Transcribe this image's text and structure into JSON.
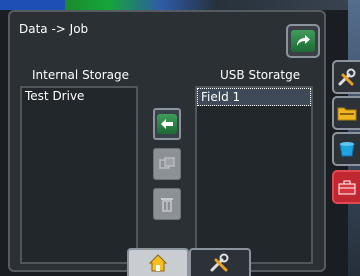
{
  "dialog": {
    "title": "Data -> Job"
  },
  "internal": {
    "label": "Internal Storage",
    "items": [
      "Test Drive"
    ]
  },
  "usb": {
    "label": "USB Storatge",
    "items": [
      "Field 1"
    ]
  },
  "icons": {
    "return": "return-arrow-icon",
    "transfer_left": "arrow-left-icon",
    "copy": "copy-icon",
    "delete": "trash-icon",
    "side_tools": "wrench-screwdriver-icon",
    "side_folder": "folder-icon",
    "side_bucket": "bucket-icon",
    "side_toolbox": "toolbox-icon",
    "bottom_home": "home-icon",
    "bottom_tools": "tools-icon"
  },
  "colors": {
    "accent_green": "#2e8b4a",
    "dialog_bg": "#2b3035",
    "selection_border": "#ffffff",
    "side_red": "#c12730"
  }
}
